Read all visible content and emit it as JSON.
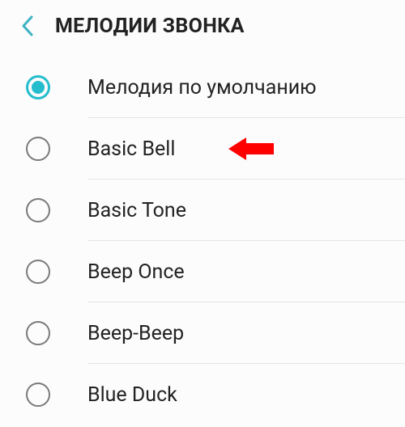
{
  "colors": {
    "accent": "#24bdcd",
    "text": "#222222",
    "radio_border": "#7a7a7a",
    "annotation": "#ff0000"
  },
  "header": {
    "title": "МЕЛОДИИ ЗВОНКА",
    "back_icon": "chevron-left"
  },
  "ringtones": {
    "selected_index": 0,
    "items": [
      {
        "label": "Мелодия по умолчанию"
      },
      {
        "label": "Basic Bell"
      },
      {
        "label": "Basic Tone"
      },
      {
        "label": "Beep Once"
      },
      {
        "label": "Beep-Beep"
      },
      {
        "label": "Blue Duck"
      }
    ],
    "annotation_arrow_on_index": 1
  }
}
